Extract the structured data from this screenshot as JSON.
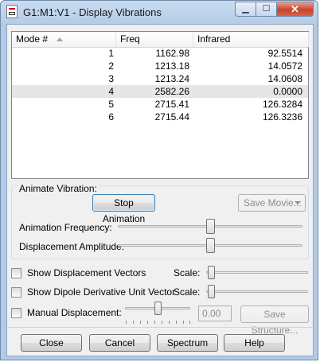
{
  "window": {
    "title": "G1:M1:V1 - Display Vibrations",
    "minimize_glyph": "▁",
    "maximize_glyph": "☐",
    "close_glyph": "✕"
  },
  "table": {
    "columns": [
      "Mode #",
      "Freq",
      "Infrared"
    ],
    "rows": [
      {
        "mode": "1",
        "freq": "1162.98",
        "ir": "92.5514"
      },
      {
        "mode": "2",
        "freq": "1213.18",
        "ir": "14.0572"
      },
      {
        "mode": "3",
        "freq": "1213.24",
        "ir": "14.0608"
      },
      {
        "mode": "4",
        "freq": "2582.26",
        "ir": "0.0000"
      },
      {
        "mode": "5",
        "freq": "2715.41",
        "ir": "126.3284"
      },
      {
        "mode": "6",
        "freq": "2715.44",
        "ir": "126.3236"
      }
    ],
    "selected_row": 3
  },
  "animate": {
    "group_label": "Animate Vibration:",
    "stop_button": "Stop Animation",
    "save_movie_button": "Save Movie...",
    "frequency_label": "Animation Frequency:",
    "frequency_level": 0.5,
    "amplitude_label": "Displacement Amplitude:",
    "amplitude_level": 0.5
  },
  "options": {
    "show_vectors_label": "Show Displacement Vectors",
    "show_vectors_checked": false,
    "show_dipole_label": "Show Dipole Derivative Unit Vector",
    "show_dipole_checked": false,
    "scale_label": "Scale:",
    "vectors_scale_level": 0.0,
    "dipole_scale_level": 0.0,
    "manual_label": "Manual Displacement:",
    "manual_checked": false,
    "manual_value": "0.00",
    "manual_level": 0.5,
    "save_structure_button": "Save Structure..."
  },
  "buttons": {
    "close": "Close",
    "cancel": "Cancel",
    "spectrum": "Spectrum",
    "help": "Help"
  }
}
